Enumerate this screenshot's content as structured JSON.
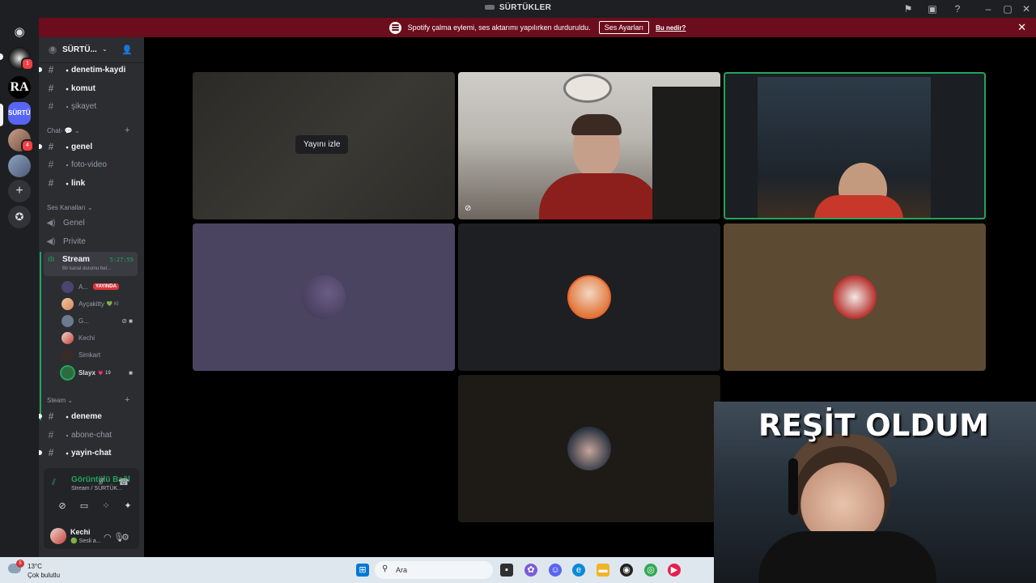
{
  "window": {
    "title": "SÜRTÜKLER"
  },
  "notice": {
    "text": "Spotify çalma eylemi, ses aktarımı yapılırken durduruldu.",
    "button": "Ses Ayarları",
    "link": "Bu nedir?"
  },
  "rail": {
    "badges": [
      "1",
      "4"
    ],
    "server_ra_label": "RA",
    "server_surtuk_label": "SÜRTÜK"
  },
  "guild": {
    "name": "SÜRTÜ...",
    "boost": "0"
  },
  "channels": {
    "top": [
      {
        "name": "denetim-kaydi",
        "prefix": "・"
      },
      {
        "name": "komut",
        "prefix": "・"
      },
      {
        "name": "şikayet",
        "prefix": "・"
      }
    ],
    "chat_category": "Chat- 💬",
    "chat": [
      {
        "name": "genel",
        "prefix": "・"
      },
      {
        "name": "foto-video",
        "prefix": "・"
      },
      {
        "name": "link",
        "prefix": "・"
      }
    ],
    "voice_category": "Ses Kanalları",
    "voice": [
      "Genel",
      "Privite"
    ],
    "stream": {
      "name": "Stream",
      "time": "5:27:55",
      "status": "Bir kanal durumu bel..."
    },
    "voice_users": [
      {
        "name": "A...",
        "live": "YAYINDA"
      },
      {
        "name": "Ayçakitty",
        "tag": "💚 Kİ"
      },
      {
        "name": "G..."
      },
      {
        "name": "Kechi"
      },
      {
        "name": "Simkart"
      },
      {
        "name": "Slayx",
        "tag": "💗 19"
      }
    ],
    "steam_category": "Steam",
    "steam": [
      {
        "name": "deneme",
        "prefix": "・"
      },
      {
        "name": "abone-chat",
        "prefix": "・"
      },
      {
        "name": "yayin-chat",
        "prefix": "・"
      }
    ]
  },
  "rtc": {
    "status": "Görüntülü Bağl",
    "location": "Stream / SÜRTÜK..."
  },
  "user": {
    "name": "Kechi",
    "status": "🟢 Sesli a..."
  },
  "grid": {
    "watch_label": "Yayını izle"
  },
  "overlay": {
    "caption": "REŞİT OLDUM"
  },
  "taskbar": {
    "weather_temp": "13°C",
    "weather_desc": "Çok bulutlu",
    "weather_badge": "5",
    "search_placeholder": "Ara"
  },
  "colors": {
    "accent_green": "#23a55a",
    "notice_red": "#6b0d1c",
    "live_red": "#da373c",
    "sidebar": "#2b2d31",
    "rail": "#1e1f22"
  }
}
